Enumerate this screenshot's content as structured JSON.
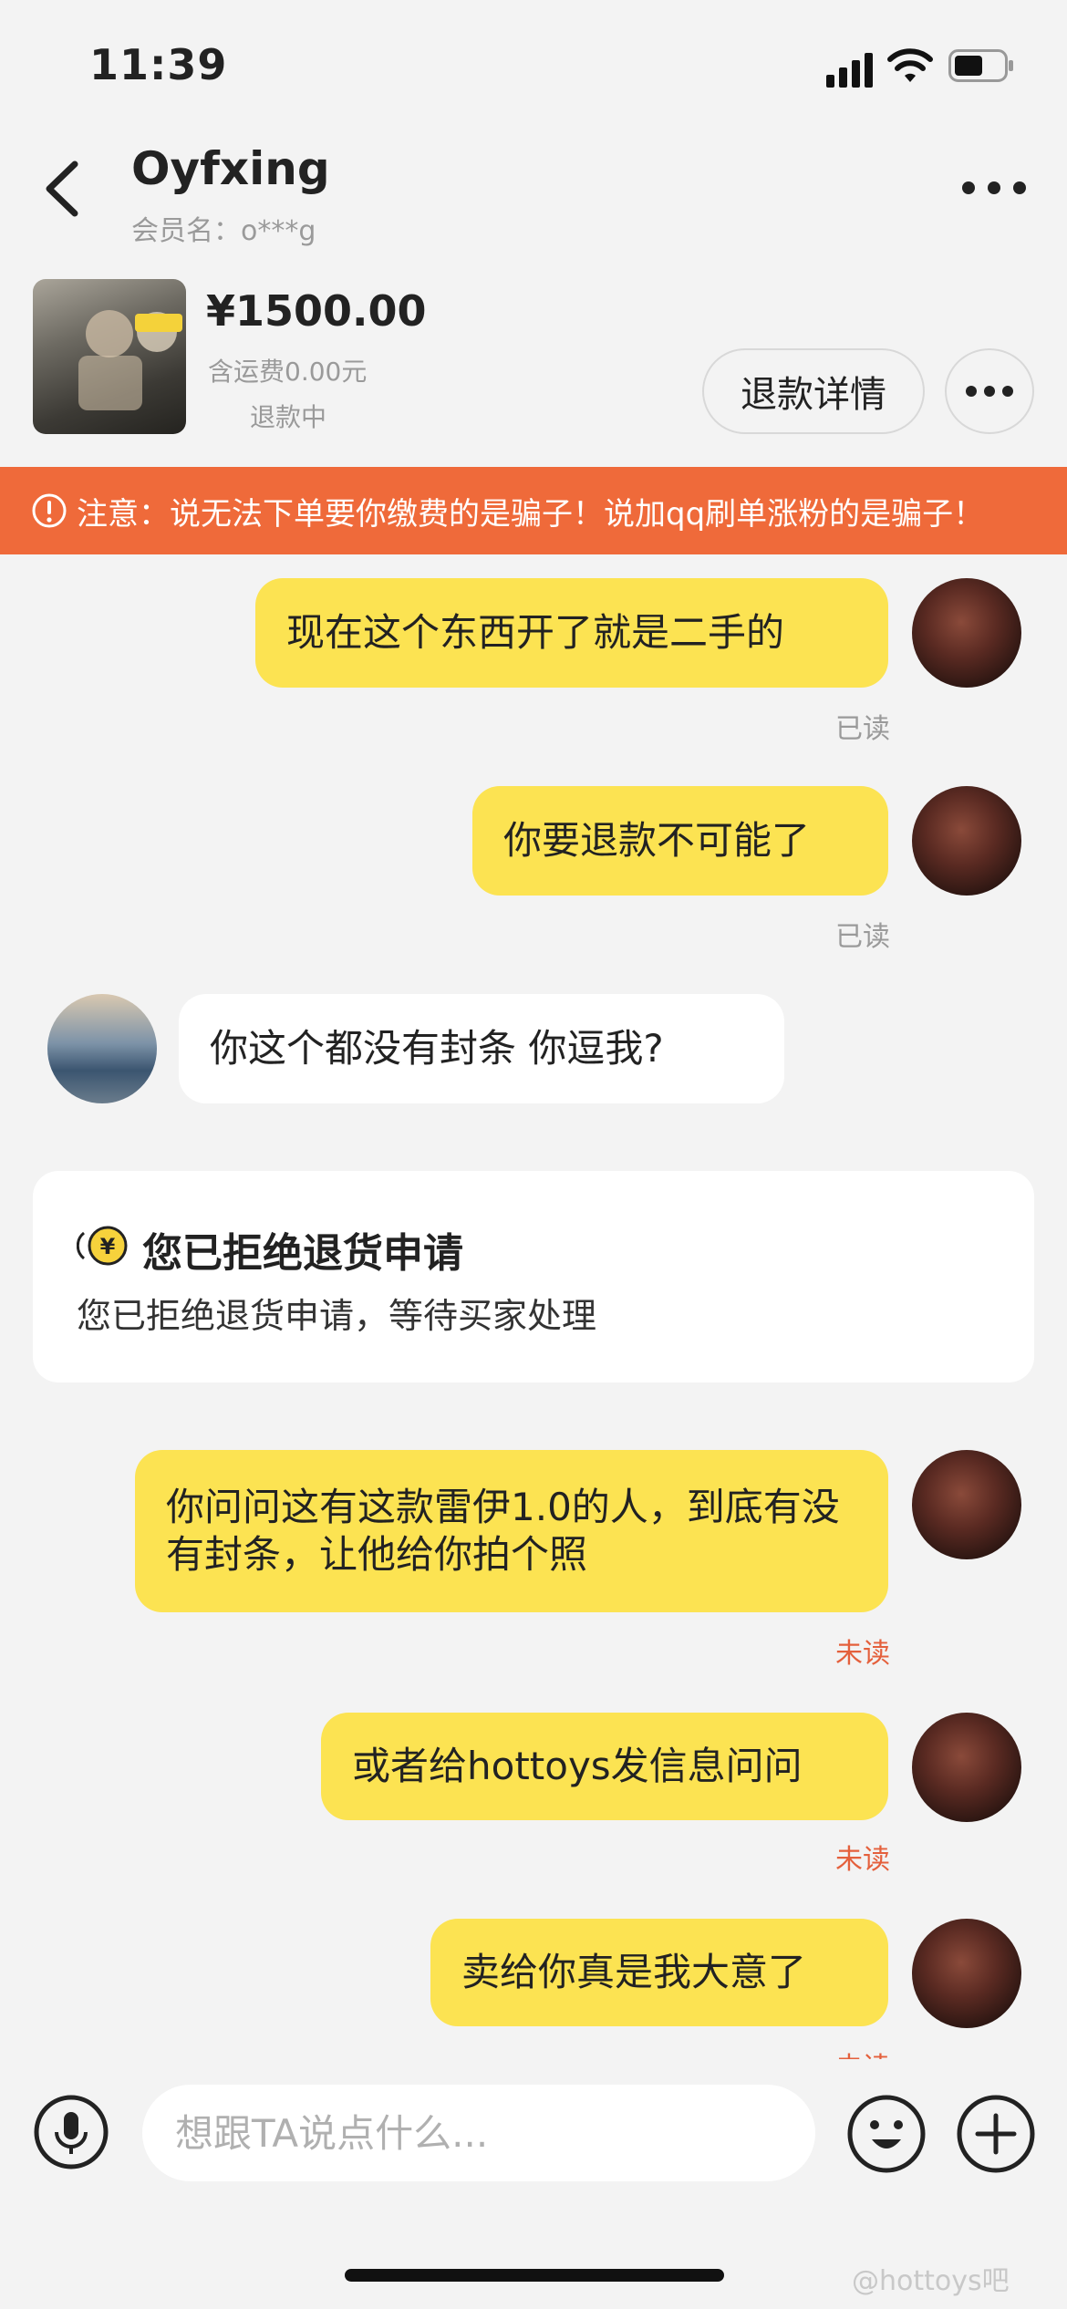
{
  "status_bar": {
    "time": "11:39"
  },
  "header": {
    "title": "Oyfxing",
    "subtitle": "会员名：o***g"
  },
  "product": {
    "price": "¥1500.00",
    "shipping": "含运费0.00元",
    "state": "退款中",
    "refund_detail_label": "退款详情"
  },
  "banner": {
    "text": "注意：说无法下单要你缴费的是骗子！说加qq刷单涨粉的是骗子！"
  },
  "messages": [
    {
      "from": "me",
      "text": "现在这个东西开了就是二手的",
      "status": "已读"
    },
    {
      "from": "me",
      "text": "你要退款不可能了",
      "status": "已读"
    },
    {
      "from": "other",
      "text": "你这个都没有封条 你逗我?"
    },
    {
      "from": "me",
      "text": "你问问这有这款雷伊1.0的人，到底有没有封条，让他给你拍个照",
      "status": "未读"
    },
    {
      "from": "me",
      "text": "或者给hottoys发信息问问",
      "status": "未读"
    },
    {
      "from": "me",
      "text": "卖给你真是我大意了",
      "status": "未读"
    }
  ],
  "system_card": {
    "title": "您已拒绝退货申请",
    "description": "您已拒绝退货申请，等待买家处理"
  },
  "input": {
    "placeholder": "想跟TA说点什么..."
  },
  "watermark": "@hottoys吧",
  "colors": {
    "my_bubble": "#fce352",
    "other_bubble": "#ffffff",
    "banner": "#ef6a3a",
    "unread": "#e4603c",
    "background": "#f3f3f3"
  }
}
